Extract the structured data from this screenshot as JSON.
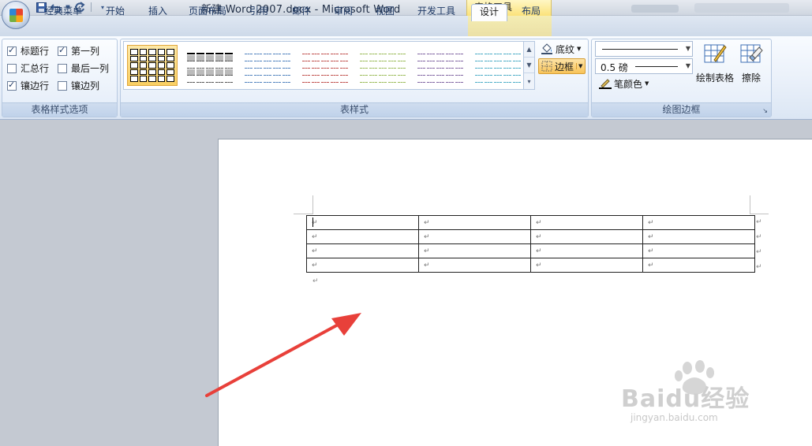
{
  "window": {
    "title": "新建 Word 2007.docx - Microsoft Word",
    "context_title": "表格工具"
  },
  "qat": {
    "icons": [
      "save-icon",
      "undo-icon",
      "redo-icon",
      "customize-icon"
    ]
  },
  "tabs": [
    {
      "label": "经典菜单"
    },
    {
      "label": "开始"
    },
    {
      "label": "插入"
    },
    {
      "label": "页面布局"
    },
    {
      "label": "引用"
    },
    {
      "label": "邮件"
    },
    {
      "label": "审阅"
    },
    {
      "label": "视图"
    },
    {
      "label": "开发工具"
    },
    {
      "label": "设计",
      "active": true
    },
    {
      "label": "布局"
    }
  ],
  "style_options": {
    "label": "表格样式选项",
    "checkboxes": [
      {
        "label": "标题行",
        "checked": true
      },
      {
        "label": "第一列",
        "checked": true
      },
      {
        "label": "汇总行",
        "checked": false
      },
      {
        "label": "最后一列",
        "checked": false
      },
      {
        "label": "镶边行",
        "checked": true
      },
      {
        "label": "镶边列",
        "checked": false
      }
    ]
  },
  "table_styles": {
    "label": "表样式",
    "shading_label": "底纹",
    "borders_label": "边框",
    "thumb_colors": [
      "#000000",
      "#555555",
      "#4f81bd",
      "#c0504d",
      "#9bbb59",
      "#8064a2",
      "#4bacc6"
    ]
  },
  "draw_borders": {
    "label": "绘图边框",
    "weight_value": "0.5 磅",
    "pen_color_label": "笔颜色",
    "draw_table_label": "绘制表格",
    "eraser_label": "擦除"
  },
  "document": {
    "paragraph_mark": "↵",
    "table": {
      "rows": 4,
      "cols": 4
    }
  },
  "colors": {
    "annotation_arrow": "#e8403a",
    "selected_style": "#f9cf62",
    "context_tab": "#fbe27a"
  },
  "watermark": {
    "brand_label": "Baidu经验",
    "site": "jingyan.baidu.com"
  }
}
